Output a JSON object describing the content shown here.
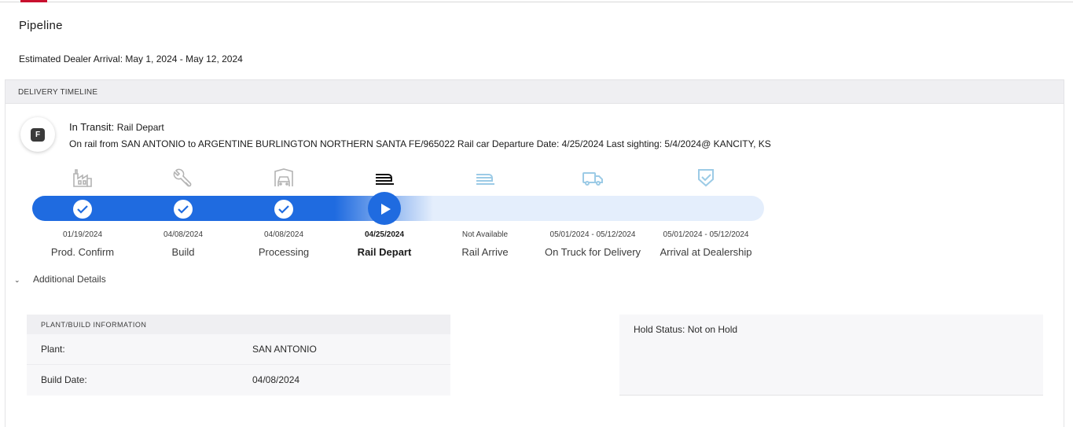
{
  "page": {
    "title": "Pipeline",
    "estimated_arrival": "Estimated Dealer Arrival: May 1, 2024 - May 12, 2024"
  },
  "timeline": {
    "header": "DELIVERY TIMELINE",
    "badge_letter": "F",
    "status_prefix": "In Transit:",
    "status_detail": "Rail Depart",
    "description": "On rail from SAN ANTONIO to ARGENTINE BURLINGTON NORTHERN SANTA FE/965022 Rail car Departure Date: 4/25/2024 Last sighting: 5/4/2024@ KANCITY, KS",
    "steps": [
      {
        "label": "Prod. Confirm",
        "date": "01/19/2024",
        "state": "complete",
        "icon": "factory-icon"
      },
      {
        "label": "Build",
        "date": "04/08/2024",
        "state": "complete",
        "icon": "wrench-icon"
      },
      {
        "label": "Processing",
        "date": "04/08/2024",
        "state": "complete",
        "icon": "car-service-icon"
      },
      {
        "label": "Rail Depart",
        "date": "04/25/2024",
        "state": "current",
        "icon": "train-icon"
      },
      {
        "label": "Rail Arrive",
        "date": "Not Available",
        "state": "pending",
        "icon": "train-icon"
      },
      {
        "label": "On Truck for Delivery",
        "date": "05/01/2024 - 05/12/2024",
        "state": "pending",
        "icon": "truck-icon"
      },
      {
        "label": "Arrival at Dealership",
        "date": "05/01/2024 - 05/12/2024",
        "state": "pending",
        "icon": "shield-check-icon"
      }
    ],
    "colors": {
      "active": "#1f6be0",
      "inactive_track": "#e4eefc",
      "pending_icon": "#9ccbe6",
      "complete_icon": "#b3b3b3"
    }
  },
  "additional": {
    "toggle_label": "Additional Details",
    "plant_card": {
      "header": "PLANT/BUILD INFORMATION",
      "rows": [
        {
          "key": "Plant:",
          "value": "SAN ANTONIO"
        },
        {
          "key": "Build Date:",
          "value": "04/08/2024"
        }
      ]
    },
    "hold_status": "Hold Status: Not on Hold"
  }
}
